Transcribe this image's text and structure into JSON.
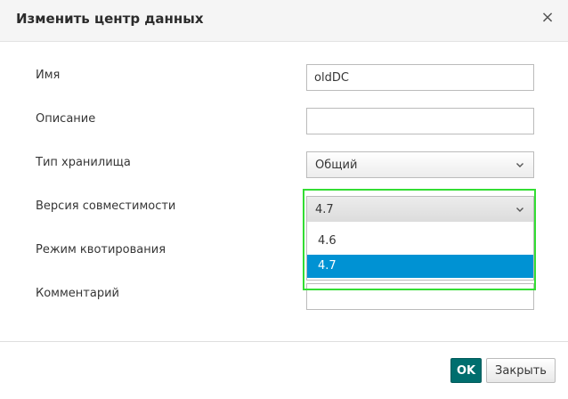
{
  "dialog": {
    "title": "Изменить центр данных",
    "close_symbol": "×"
  },
  "form": {
    "name": {
      "label": "Имя",
      "value": "oldDC"
    },
    "description": {
      "label": "Описание",
      "value": ""
    },
    "storage_type": {
      "label": "Тип хранилища",
      "selected": "Общий"
    },
    "compatibility_version": {
      "label": "Версия совместимости",
      "selected": "4.7",
      "dropdown_open": true,
      "options": [
        "4.6",
        "4.7"
      ],
      "highlighted_option": "4.7"
    },
    "quota_mode": {
      "label": "Режим квотирования"
    },
    "comment": {
      "label": "Комментарий",
      "value": ""
    }
  },
  "footer": {
    "ok_label": "OK",
    "close_label": "Закрыть"
  },
  "colors": {
    "header_bg": "#f5f5f5",
    "option_highlight": "#0092d3",
    "ok_button": "#006e6e",
    "focus_frame": "#33dd33"
  },
  "icons": {
    "close": "close-icon",
    "chevron": "chevron-down-icon"
  }
}
